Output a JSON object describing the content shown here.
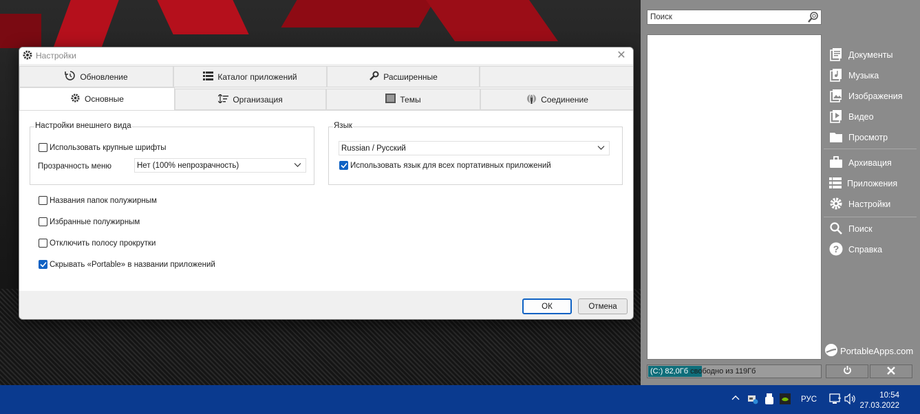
{
  "dialog": {
    "title": "Настройки",
    "tabs_row1": [
      {
        "label": "Обновление",
        "icon": "update-icon"
      },
      {
        "label": "Каталог приложений",
        "icon": "list-icon"
      },
      {
        "label": "Расширенные",
        "icon": "wrench-icon"
      }
    ],
    "tabs_row2": [
      {
        "label": "Основные",
        "icon": "gear-icon",
        "active": true
      },
      {
        "label": "Организация",
        "icon": "sort-icon"
      },
      {
        "label": "Темы",
        "icon": "theme-icon"
      },
      {
        "label": "Соединение",
        "icon": "globe-icon"
      }
    ],
    "appearance": {
      "group_label": "Настройки внешнего вида",
      "large_fonts": {
        "label": "Использовать крупные шрифты",
        "checked": false
      },
      "menu_transparency_label": "Прозрачность меню",
      "menu_transparency_value": "Нет (100% непрозрачность)"
    },
    "language": {
      "group_label": "Язык",
      "value": "Russian / Русский",
      "all_apps": {
        "label": "Использовать язык для всех портативных приложений",
        "checked": true
      }
    },
    "options": [
      {
        "label": "Названия папок полужирным",
        "checked": false
      },
      {
        "label": "Избранные полужирным",
        "checked": false
      },
      {
        "label": "Отключить полосу прокрутки",
        "checked": false
      },
      {
        "label": "Скрывать «Portable» в названии приложений",
        "checked": true
      }
    ],
    "ok_label": "ОК",
    "cancel_label": "Отмена"
  },
  "panel": {
    "search_placeholder": "Поиск",
    "menu_group1": [
      {
        "label": "Документы",
        "icon": "documents-icon"
      },
      {
        "label": "Музыка",
        "icon": "music-icon"
      },
      {
        "label": "Изображения",
        "icon": "images-icon"
      },
      {
        "label": "Видео",
        "icon": "video-icon"
      },
      {
        "label": "Просмотр",
        "icon": "folder-icon"
      }
    ],
    "menu_group2": [
      {
        "label": "Архивация",
        "icon": "briefcase-icon"
      },
      {
        "label": "Приложения",
        "icon": "apps-icon"
      },
      {
        "label": "Настройки",
        "icon": "settings-icon"
      }
    ],
    "menu_group3": [
      {
        "label": "Поиск",
        "icon": "search-icon"
      },
      {
        "label": "Справка",
        "icon": "help-icon"
      }
    ],
    "brand": "PortableApps.com",
    "disk_used_text": "(C:) 82,0Гб",
    "disk_rest_text": " свободно из 119Гб",
    "disk_used_fraction": 0.31,
    "power_icon": "power-icon",
    "close_icon": "close-icon"
  },
  "taskbar": {
    "lang": "РУС",
    "time": "10:54",
    "date": "27.03.2022"
  },
  "colors": {
    "accent": "#0f62c4",
    "panel": "#8b8b8b",
    "taskbar": "#0a3a8f"
  }
}
